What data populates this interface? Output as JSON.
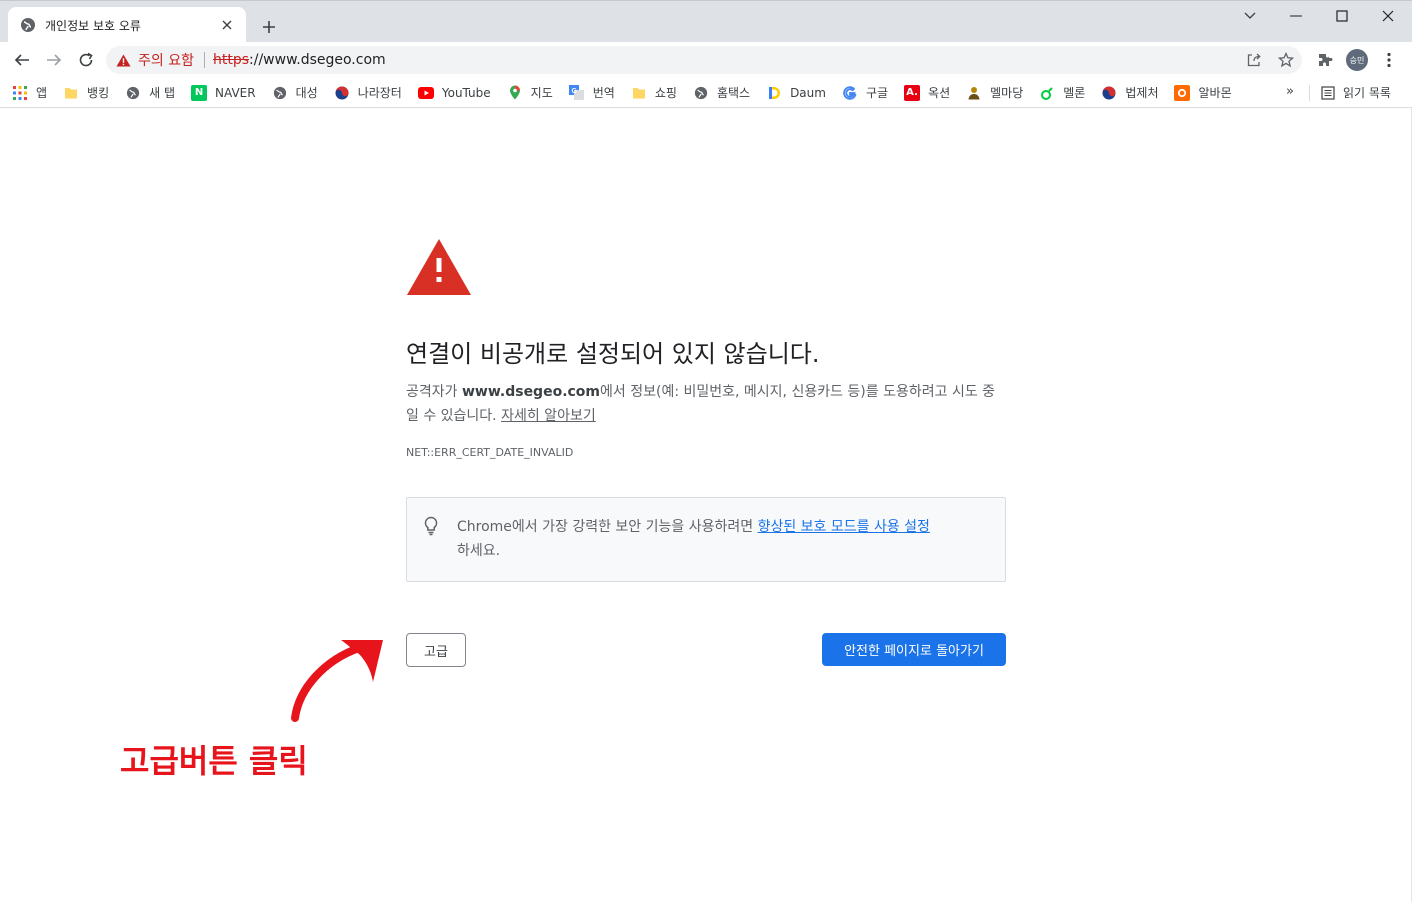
{
  "window": {
    "tab_title": "개인정보 보호 오류",
    "tab_favicon": "globe-icon",
    "controls": [
      "chevron-down-icon",
      "minimize-icon",
      "maximize-icon",
      "close-icon"
    ]
  },
  "toolbar": {
    "security_label": "주의 요함",
    "url_scheme": "https",
    "url_rest": "://www.dsegeo.com",
    "icons": [
      "back-icon",
      "forward-icon",
      "reload-icon",
      "share-icon",
      "star-icon",
      "extensions-icon",
      "kebab-menu-icon"
    ],
    "profile_label": "승민"
  },
  "bookmarks": {
    "items": [
      {
        "label": "앱",
        "icon": "apps-grid-icon"
      },
      {
        "label": "뱅킹",
        "icon": "folder-icon"
      },
      {
        "label": "새 탭",
        "icon": "globe-icon"
      },
      {
        "label": "NAVER",
        "icon": "naver-icon"
      },
      {
        "label": "대성",
        "icon": "globe-icon"
      },
      {
        "label": "나라장터",
        "icon": "taegeuk-icon"
      },
      {
        "label": "YouTube",
        "icon": "youtube-icon"
      },
      {
        "label": "지도",
        "icon": "map-pin-icon"
      },
      {
        "label": "번역",
        "icon": "translate-icon"
      },
      {
        "label": "쇼핑",
        "icon": "folder-icon"
      },
      {
        "label": "홈택스",
        "icon": "globe-icon"
      },
      {
        "label": "Daum",
        "icon": "daum-icon"
      },
      {
        "label": "구글",
        "icon": "google-icon"
      },
      {
        "label": "옥션",
        "icon": "auction-icon"
      },
      {
        "label": "멜마당",
        "icon": "person-icon"
      },
      {
        "label": "멜론",
        "icon": "melon-icon"
      },
      {
        "label": "법제처",
        "icon": "taegeuk-icon"
      },
      {
        "label": "알바몬",
        "icon": "albamon-icon"
      }
    ],
    "more": "»",
    "reading_list": "읽기 목록"
  },
  "page": {
    "heading": "연결이 비공개로 설정되어 있지 않습니다.",
    "desc_pre": "공격자가 ",
    "desc_domain": "www.dsegeo.com",
    "desc_post": "에서 정보(예: 비밀번호, 메시지, 신용카드 등)를 도용하려고 시도 중일 수 있습니다. ",
    "learn_more": "자세히 알아보기",
    "error_code": "NET::ERR_CERT_DATE_INVALID",
    "enhanced_pre": "Chrome에서 가장 강력한 보안 기능을 사용하려면 ",
    "enhanced_link": "향상된 보호 모드를 사용 설정",
    "enhanced_post": "하세요.",
    "advanced_button": "고급",
    "back_button": "안전한 페이지로 돌아가기"
  },
  "annotation": {
    "text": "고급버튼 클릭",
    "color": "#e8141c"
  },
  "colors": {
    "warning_red": "#d93025",
    "primary_blue": "#1a73e8",
    "tabstrip": "#dee1e6"
  }
}
